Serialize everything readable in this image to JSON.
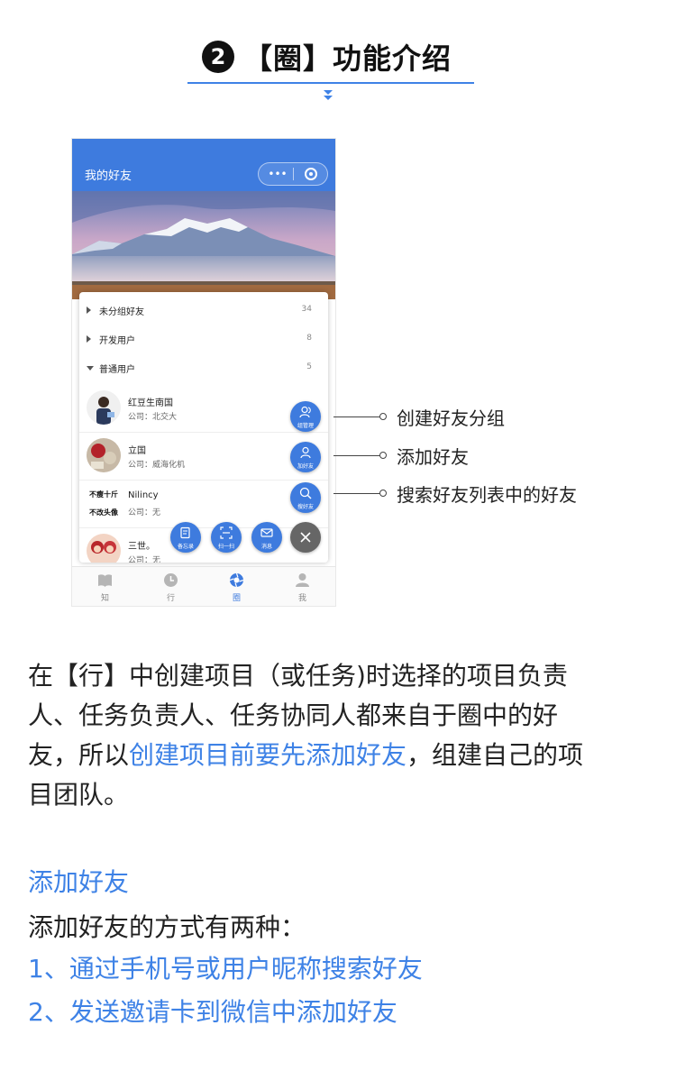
{
  "header": {
    "number": "2",
    "title": "【圈】功能介绍"
  },
  "phone": {
    "nav_title": "我的好友",
    "capsule_more": "•••",
    "groups": [
      {
        "label": "未分组好友",
        "count": "34"
      },
      {
        "label": "开发用户",
        "count": "8"
      },
      {
        "label": "普通用户",
        "count": "5"
      }
    ],
    "friends": [
      {
        "name": "红豆生南国",
        "company": "公司：北交大"
      },
      {
        "name": "立国",
        "company": "公司：威海化机"
      },
      {
        "name": "Nilincy",
        "company": "公司：无",
        "avatar_text_1": "不瘦十斤",
        "avatar_text_2": "不改头像"
      },
      {
        "name": "三世。",
        "company": "公司：无"
      }
    ],
    "fabs": {
      "group_manage": "组管理",
      "add_friend": "加好友",
      "search_friend": "搜好友",
      "memo": "备忘录",
      "scan": "扫一扫",
      "message": "消息"
    },
    "tabs": [
      {
        "label": "知",
        "icon": "book-icon"
      },
      {
        "label": "行",
        "icon": "clock-icon"
      },
      {
        "label": "圈",
        "icon": "aperture-icon",
        "active": true
      },
      {
        "label": "我",
        "icon": "person-icon"
      }
    ],
    "accent": "#3e7bde"
  },
  "callouts": [
    "创建好友分组",
    "添加好友",
    "搜索好友列表中的好友"
  ],
  "paragraph": {
    "line1": "在【行】中创建项目（或任务)时选择的项目负责",
    "line2": "人、任务负责人、任务协同人都来自于圈中的好",
    "line3_a": "友，所以",
    "line3_highlight": "创建项目前要先添加好友",
    "line3_b": "，组建自己的项",
    "line4": "目团队。"
  },
  "add_section": {
    "title": "添加好友",
    "intro": "添加好友的方式有两种：",
    "method1": "1、通过手机号或用户昵称搜索好友",
    "method2": "2、发送邀请卡到微信中添加好友"
  }
}
